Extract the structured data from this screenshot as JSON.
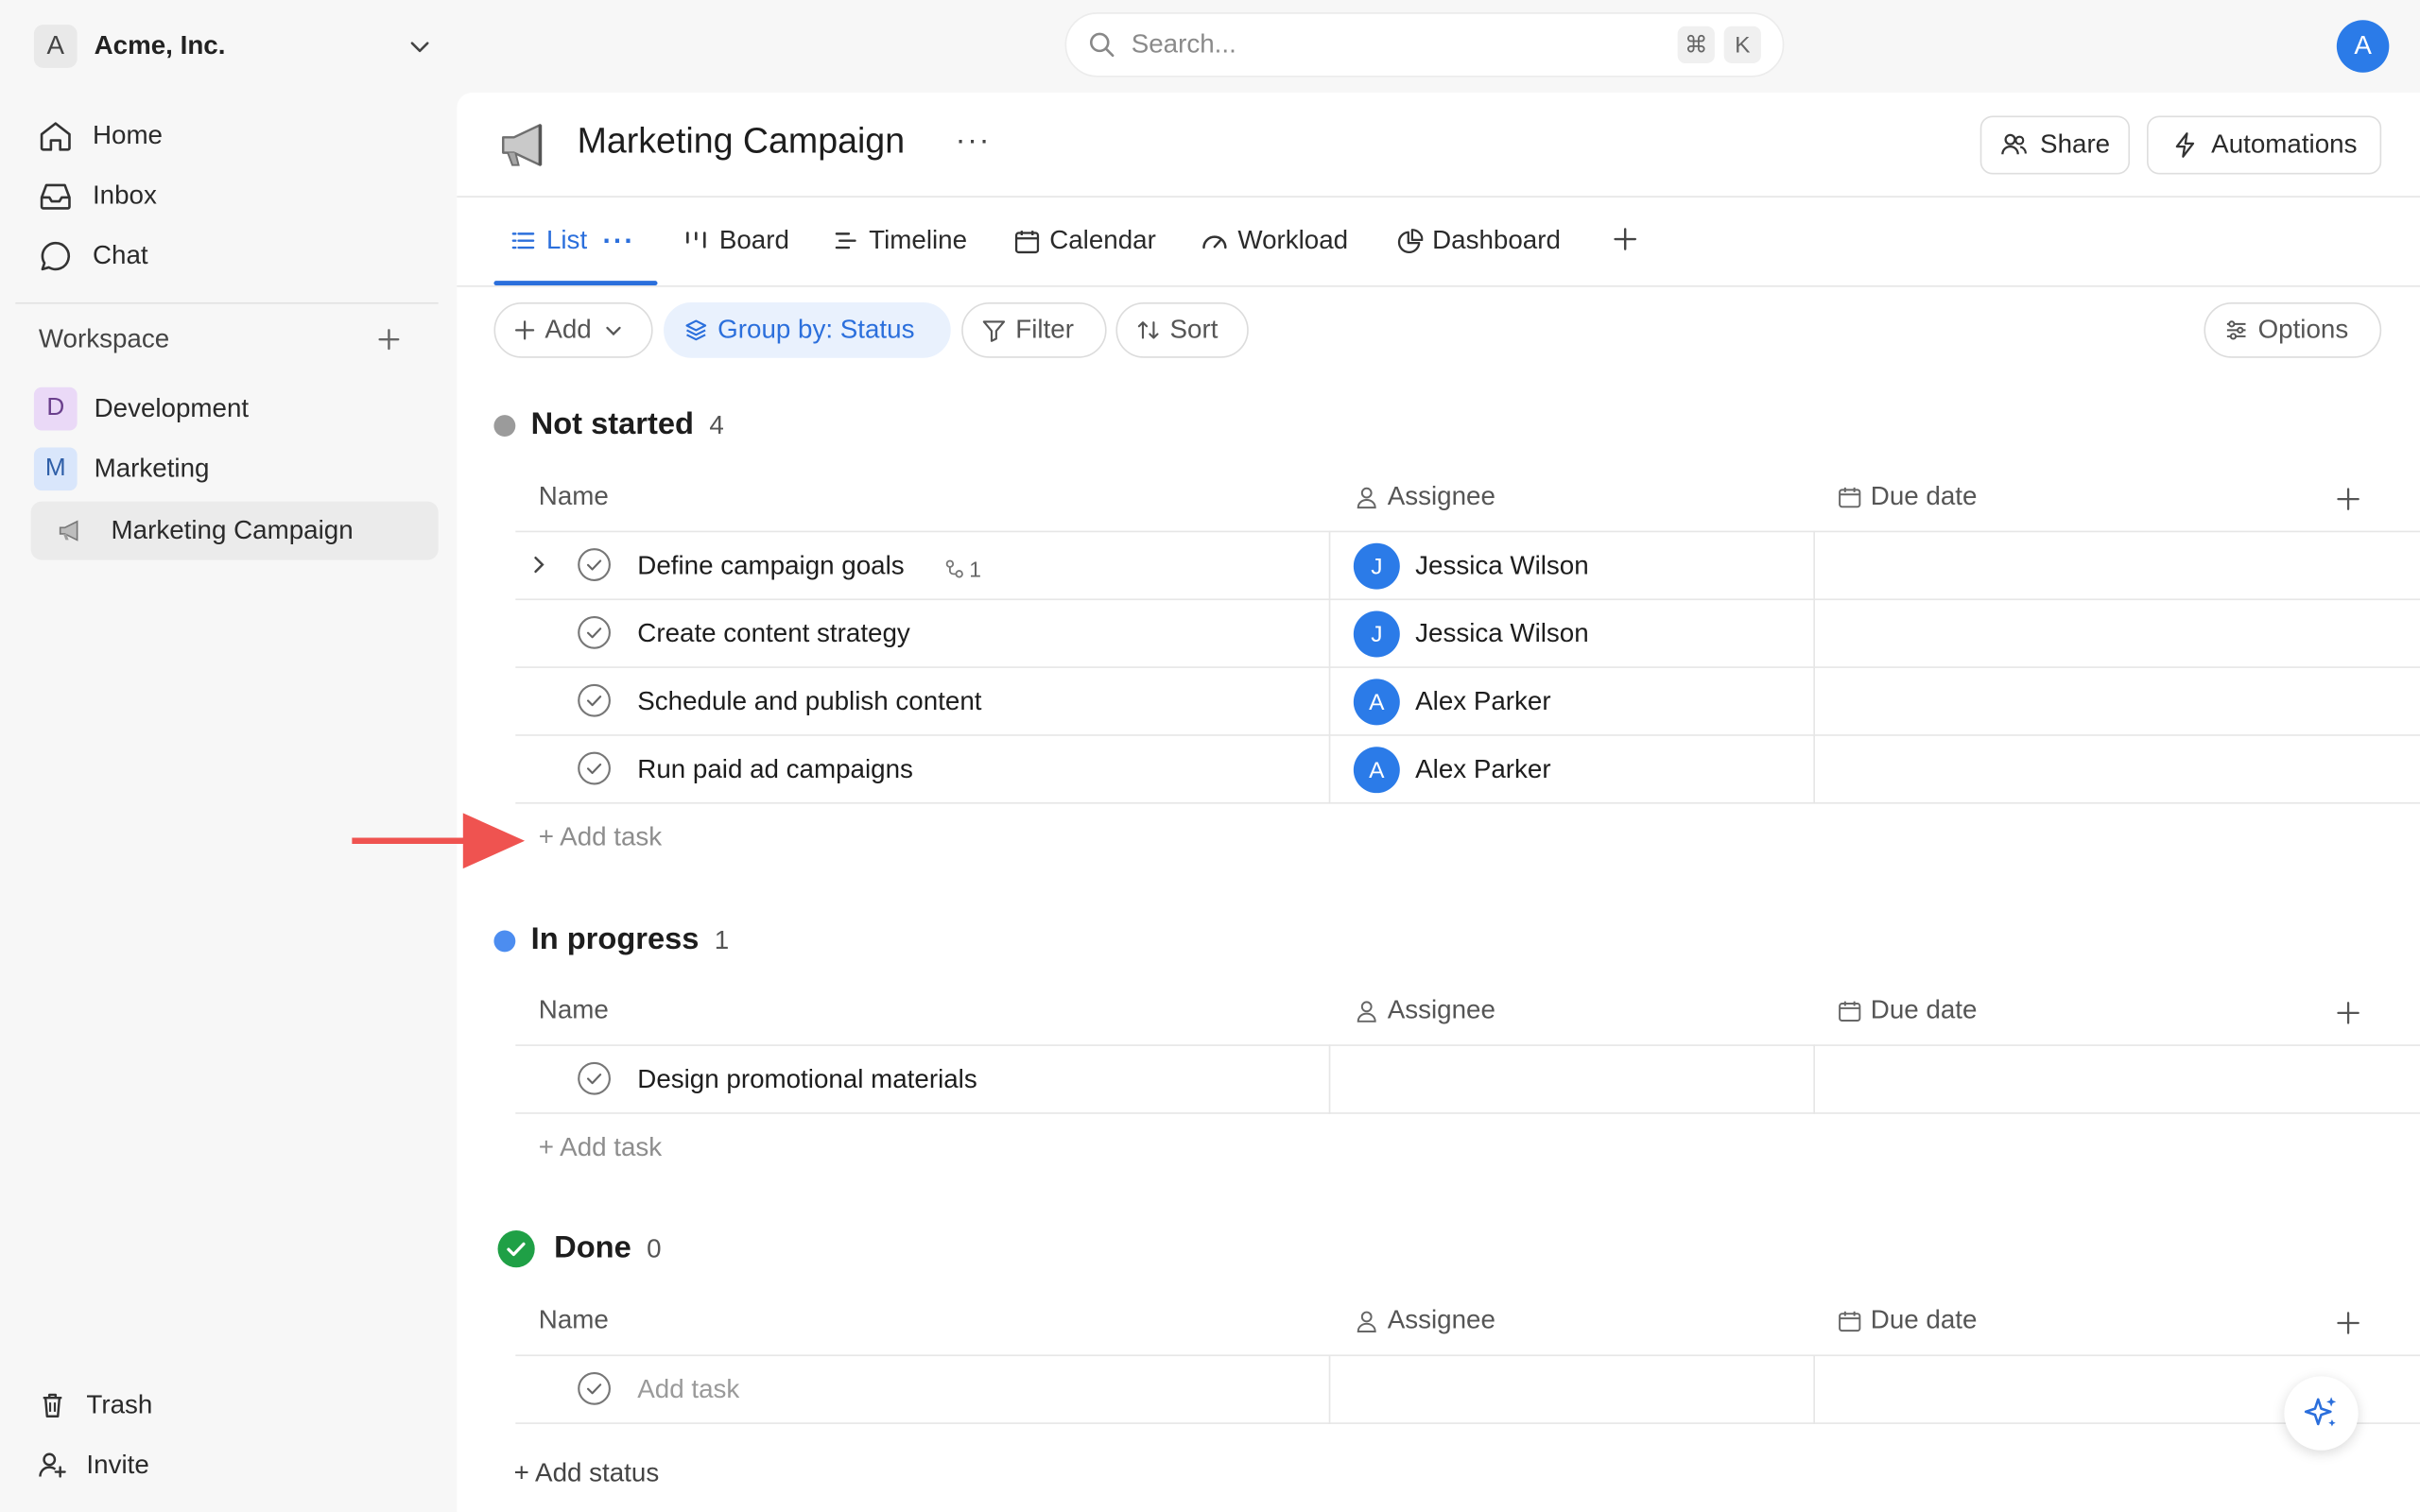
{
  "workspace_switcher": {
    "initial": "A",
    "name": "Acme, Inc."
  },
  "search": {
    "placeholder": "Search...",
    "shortcut_mod": "⌘",
    "shortcut_key": "K"
  },
  "user": {
    "initial": "A"
  },
  "sidebar": {
    "nav": [
      {
        "label": "Home",
        "icon": "home-icon"
      },
      {
        "label": "Inbox",
        "icon": "inbox-icon"
      },
      {
        "label": "Chat",
        "icon": "chat-icon"
      }
    ],
    "workspace_label": "Workspace",
    "spaces": [
      {
        "initial": "D",
        "label": "Development",
        "color": "#ead9f7"
      },
      {
        "initial": "M",
        "label": "Marketing",
        "color": "#d9e6fb"
      }
    ],
    "active_project": "Marketing Campaign",
    "bottom": [
      {
        "label": "Trash",
        "icon": "trash-icon"
      },
      {
        "label": "Invite",
        "icon": "invite-icon"
      }
    ]
  },
  "project": {
    "title": "Marketing Campaign",
    "more": "···",
    "share_label": "Share",
    "automations_label": "Automations"
  },
  "tabs": [
    {
      "label": "List",
      "active": true,
      "icon": "list-icon"
    },
    {
      "label": "Board",
      "icon": "board-icon"
    },
    {
      "label": "Timeline",
      "icon": "timeline-icon"
    },
    {
      "label": "Calendar",
      "icon": "calendar-icon"
    },
    {
      "label": "Workload",
      "icon": "gauge-icon"
    },
    {
      "label": "Dashboard",
      "icon": "pie-icon"
    }
  ],
  "tab_more": "···",
  "toolbar": {
    "add_label": "Add",
    "group_label": "Group by: Status",
    "filter_label": "Filter",
    "sort_label": "Sort",
    "options_label": "Options"
  },
  "columns": {
    "name": "Name",
    "assignee": "Assignee",
    "due": "Due date"
  },
  "groups": [
    {
      "title": "Not started",
      "count": "4",
      "color": "#9b9b9b",
      "tasks": [
        {
          "name": "Define campaign goals",
          "subtasks": "1",
          "assignee": "Jessica Wilson",
          "initial": "J"
        },
        {
          "name": "Create content strategy",
          "assignee": "Jessica Wilson",
          "initial": "J"
        },
        {
          "name": "Schedule and publish content",
          "assignee": "Alex Parker",
          "initial": "A"
        },
        {
          "name": "Run paid ad campaigns",
          "assignee": "Alex Parker",
          "initial": "A"
        }
      ],
      "add_task": "+ Add task"
    },
    {
      "title": "In progress",
      "count": "1",
      "color": "#4c8df0",
      "tasks": [
        {
          "name": "Design promotional materials"
        }
      ],
      "add_task": "+ Add task"
    },
    {
      "title": "Done",
      "count": "0",
      "color": "#1fa046",
      "placeholder_task": "Add task"
    }
  ],
  "add_status": "+ Add status",
  "colors": {
    "accent": "#2b6fdc",
    "annotation_arrow": "#ef5350"
  }
}
